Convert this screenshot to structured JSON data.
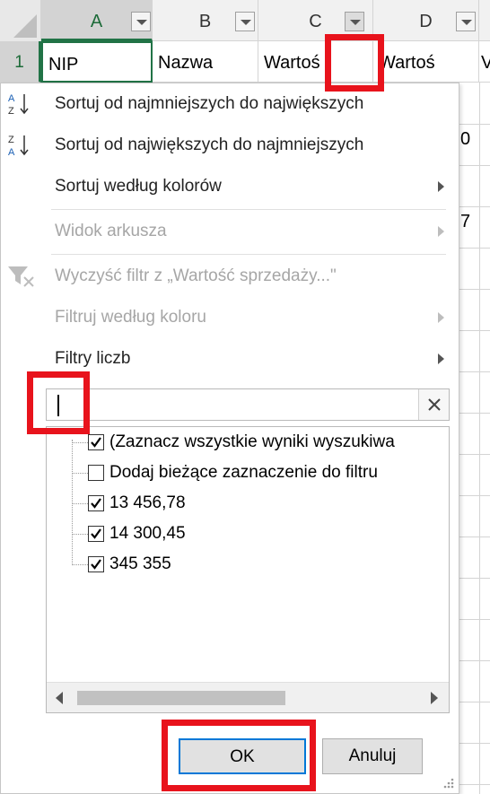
{
  "sheet": {
    "columns": [
      "A",
      "B",
      "C",
      "D"
    ],
    "row_number": "1",
    "headers": [
      "NIP",
      "Nazwa",
      "Wartoś",
      "Wartoś",
      "V"
    ],
    "peek_values": [
      "0",
      "7"
    ]
  },
  "menu": {
    "sort_asc": "Sortuj od najmniejszych do największych",
    "sort_desc": "Sortuj od największych do najmniejszych",
    "sort_color": "Sortuj według kolorów",
    "sheet_view": "Widok arkusza",
    "clear_filter": "Wyczyść filtr z „Wartość sprzedaży...\"",
    "filter_color": "Filtruj według koloru",
    "number_filters": "Filtry liczb"
  },
  "search": {
    "value": "",
    "placeholder": ""
  },
  "list": {
    "items": [
      {
        "label": "(Zaznacz wszystkie wyniki wyszukiwa",
        "checked": true
      },
      {
        "label": "Dodaj bieżące zaznaczenie do filtru",
        "checked": false
      },
      {
        "label": "13 456,78",
        "checked": true
      },
      {
        "label": "14 300,45",
        "checked": true
      },
      {
        "label": "345 355",
        "checked": true
      }
    ]
  },
  "buttons": {
    "ok": "OK",
    "cancel": "Anuluj"
  },
  "colors": {
    "highlight": "#e8131c",
    "excel_green": "#217346",
    "default_button_border": "#0078d7"
  }
}
